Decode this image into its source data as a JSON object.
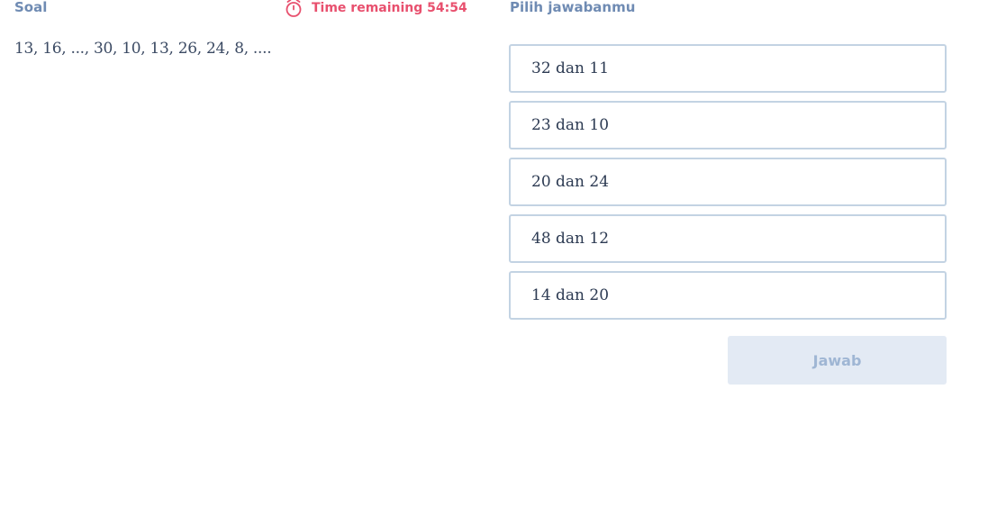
{
  "header": {
    "question_label": "Soal",
    "timer_text": "Time remaining 54:54",
    "answer_label": "Pilih jawabanmu"
  },
  "question": {
    "text": "13, 16, ..., 30, 10, 13, 26, 24, 8, ...."
  },
  "options": [
    {
      "label": "32 dan 11"
    },
    {
      "label": "23 dan 10"
    },
    {
      "label": "20 dan 24"
    },
    {
      "label": "48 dan 12"
    },
    {
      "label": "14 dan 20"
    }
  ],
  "submit": {
    "label": "Jawab"
  },
  "colors": {
    "label": "#6f8bb3",
    "timer": "#e8506e",
    "option_border": "#c3d3e3",
    "submit_bg": "#e3eaf4",
    "submit_text": "#9fb6d4"
  },
  "icons": {
    "timer": "alarm-clock-icon"
  }
}
